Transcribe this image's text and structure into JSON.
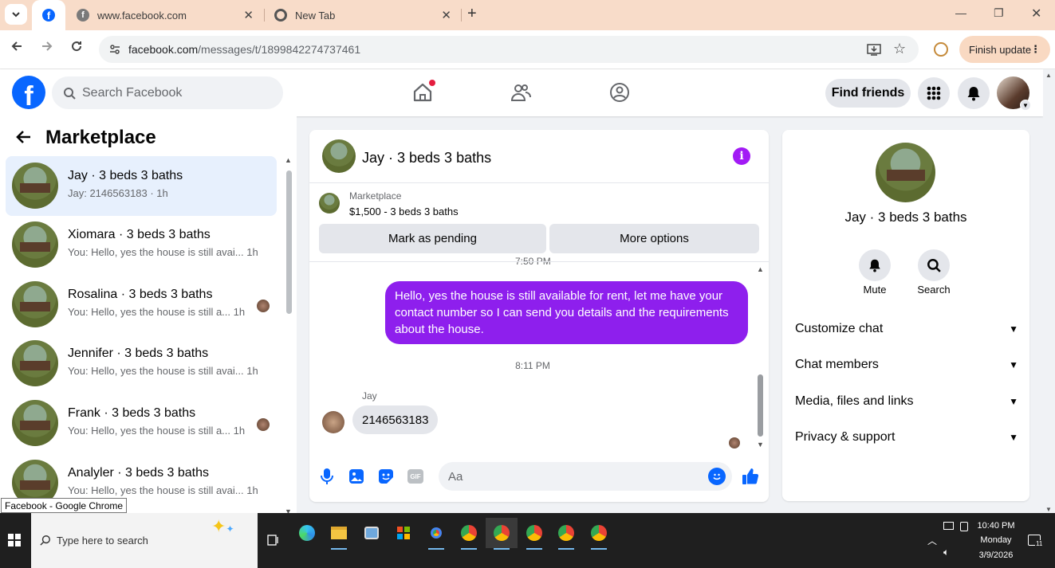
{
  "browser": {
    "tabs": [
      {
        "title": "",
        "active": true
      },
      {
        "title": "www.facebook.com",
        "active": false
      },
      {
        "title": "New Tab",
        "active": false
      }
    ],
    "url_host": "facebook.com",
    "url_path": "/messages/t/1899842274737461",
    "finish_update_label": "Finish update"
  },
  "header": {
    "search_placeholder": "Search Facebook",
    "find_friends_label": "Find friends"
  },
  "sidebar": {
    "title": "Marketplace",
    "conversations": [
      {
        "name": "Jay · 3 beds 3 baths",
        "preview": "Jay: 2146563183 · 1h",
        "selected": true
      },
      {
        "name": "Xiomara · 3 beds 3 baths",
        "preview": "You: Hello, yes the house is still avai... 1h"
      },
      {
        "name": "Rosalina · 3 beds 3 baths",
        "preview": "You: Hello, yes the house is still a... 1h"
      },
      {
        "name": "Jennifer · 3 beds 3 baths",
        "preview": "You: Hello, yes the house is still avai... 1h"
      },
      {
        "name": "Frank · 3 beds 3 baths",
        "preview": "You: Hello, yes the house is still a... 1h"
      },
      {
        "name": "Analyler · 3 beds 3 baths",
        "preview": "You: Hello, yes the house is still avai... 1h"
      }
    ]
  },
  "chat": {
    "title": "Jay · 3 beds 3 baths",
    "marketplace_label": "Marketplace",
    "listing": "$1,500 - 3 beds 3 baths",
    "mark_pending_label": "Mark as pending",
    "more_options_label": "More options",
    "cut_timestamp": "7:50 PM",
    "outgoing_message": "Hello, yes the house is still available for rent, let me have your contact number so I can send you details and the requirements about the house.",
    "timestamp": "8:11 PM",
    "sender_name": "Jay",
    "incoming_message": "2146563183",
    "composer_placeholder": "Aa",
    "accent_color": "#8e1fed"
  },
  "details": {
    "name": "Jay · 3 beds 3 baths",
    "mute_label": "Mute",
    "search_label": "Search",
    "sections": [
      "Customize chat",
      "Chat members",
      "Media, files and links",
      "Privacy & support"
    ]
  },
  "tooltip": "Facebook - Google Chrome",
  "taskbar": {
    "search_placeholder": "Type here to search",
    "time": "10:40 PM",
    "day": "Monday",
    "date": "3/9/2026",
    "notification_count": "11"
  }
}
